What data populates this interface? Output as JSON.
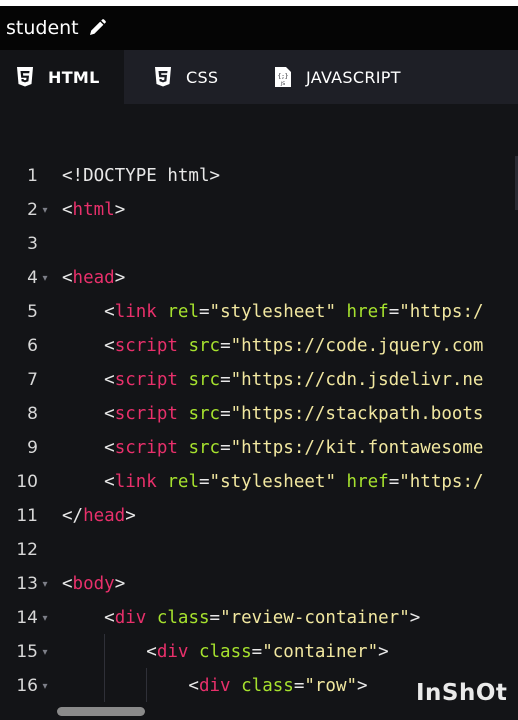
{
  "project": {
    "title": "student"
  },
  "tabs": [
    {
      "label": "HTML",
      "icon": "html5-icon",
      "active": true
    },
    {
      "label": "CSS",
      "icon": "css3-icon",
      "active": false
    },
    {
      "label": "JAVASCRIPT",
      "icon": "js-file-icon",
      "active": false
    }
  ],
  "colors": {
    "tag": "#e8306b",
    "attribute": "#a6e22e",
    "string": "#f1e7a0",
    "text": "#e8e8e8",
    "editor_bg": "#131417",
    "tabbar_bg": "#1e1f26"
  },
  "code_lines": [
    {
      "num": "1",
      "fold": false,
      "tokens": [
        [
          "d",
          "<!DOCTYPE html>"
        ]
      ]
    },
    {
      "num": "2",
      "fold": true,
      "tokens": [
        [
          "d",
          "<"
        ],
        [
          "t",
          "html"
        ],
        [
          "d",
          ">"
        ]
      ]
    },
    {
      "num": "3",
      "fold": false,
      "tokens": []
    },
    {
      "num": "4",
      "fold": true,
      "tokens": [
        [
          "d",
          "<"
        ],
        [
          "t",
          "head"
        ],
        [
          "d",
          ">"
        ]
      ]
    },
    {
      "num": "5",
      "fold": false,
      "tokens": [
        [
          "d",
          "    <"
        ],
        [
          "t",
          "link"
        ],
        [
          "d",
          " "
        ],
        [
          "a",
          "rel"
        ],
        [
          "d",
          "="
        ],
        [
          "s",
          "\"stylesheet\""
        ],
        [
          "d",
          " "
        ],
        [
          "a",
          "href"
        ],
        [
          "d",
          "="
        ],
        [
          "s",
          "\"https:/"
        ]
      ]
    },
    {
      "num": "6",
      "fold": false,
      "tokens": [
        [
          "d",
          "    <"
        ],
        [
          "t",
          "script"
        ],
        [
          "d",
          " "
        ],
        [
          "a",
          "src"
        ],
        [
          "d",
          "="
        ],
        [
          "s",
          "\"https://code.jquery.com"
        ]
      ]
    },
    {
      "num": "7",
      "fold": false,
      "tokens": [
        [
          "d",
          "    <"
        ],
        [
          "t",
          "script"
        ],
        [
          "d",
          " "
        ],
        [
          "a",
          "src"
        ],
        [
          "d",
          "="
        ],
        [
          "s",
          "\"https://cdn.jsdelivr.ne"
        ]
      ]
    },
    {
      "num": "8",
      "fold": false,
      "tokens": [
        [
          "d",
          "    <"
        ],
        [
          "t",
          "script"
        ],
        [
          "d",
          " "
        ],
        [
          "a",
          "src"
        ],
        [
          "d",
          "="
        ],
        [
          "s",
          "\"https://stackpath.boots"
        ]
      ]
    },
    {
      "num": "9",
      "fold": false,
      "tokens": [
        [
          "d",
          "    <"
        ],
        [
          "t",
          "script"
        ],
        [
          "d",
          " "
        ],
        [
          "a",
          "src"
        ],
        [
          "d",
          "="
        ],
        [
          "s",
          "\"https://kit.fontawesome"
        ]
      ]
    },
    {
      "num": "10",
      "fold": false,
      "tokens": [
        [
          "d",
          "    <"
        ],
        [
          "t",
          "link"
        ],
        [
          "d",
          " "
        ],
        [
          "a",
          "rel"
        ],
        [
          "d",
          "="
        ],
        [
          "s",
          "\"stylesheet\""
        ],
        [
          "d",
          " "
        ],
        [
          "a",
          "href"
        ],
        [
          "d",
          "="
        ],
        [
          "s",
          "\"https:/"
        ]
      ]
    },
    {
      "num": "11",
      "fold": false,
      "tokens": [
        [
          "d",
          "</"
        ],
        [
          "t",
          "head"
        ],
        [
          "d",
          ">"
        ]
      ]
    },
    {
      "num": "12",
      "fold": false,
      "tokens": []
    },
    {
      "num": "13",
      "fold": true,
      "tokens": [
        [
          "d",
          "<"
        ],
        [
          "t",
          "body"
        ],
        [
          "d",
          ">"
        ]
      ]
    },
    {
      "num": "14",
      "fold": true,
      "tokens": [
        [
          "d",
          "    <"
        ],
        [
          "t",
          "div"
        ],
        [
          "d",
          " "
        ],
        [
          "a",
          "class"
        ],
        [
          "d",
          "="
        ],
        [
          "s",
          "\"review-container\""
        ],
        [
          "d",
          ">"
        ]
      ]
    },
    {
      "num": "15",
      "fold": true,
      "tokens": [
        [
          "d",
          "        <"
        ],
        [
          "t",
          "div"
        ],
        [
          "d",
          " "
        ],
        [
          "a",
          "class"
        ],
        [
          "d",
          "="
        ],
        [
          "s",
          "\"container\""
        ],
        [
          "d",
          ">"
        ]
      ]
    },
    {
      "num": "16",
      "fold": true,
      "tokens": [
        [
          "d",
          "            <"
        ],
        [
          "t",
          "div"
        ],
        [
          "d",
          " "
        ],
        [
          "a",
          "class"
        ],
        [
          "d",
          "="
        ],
        [
          "s",
          "\"row\""
        ],
        [
          "d",
          ">"
        ]
      ]
    }
  ],
  "watermark": "InShOt"
}
